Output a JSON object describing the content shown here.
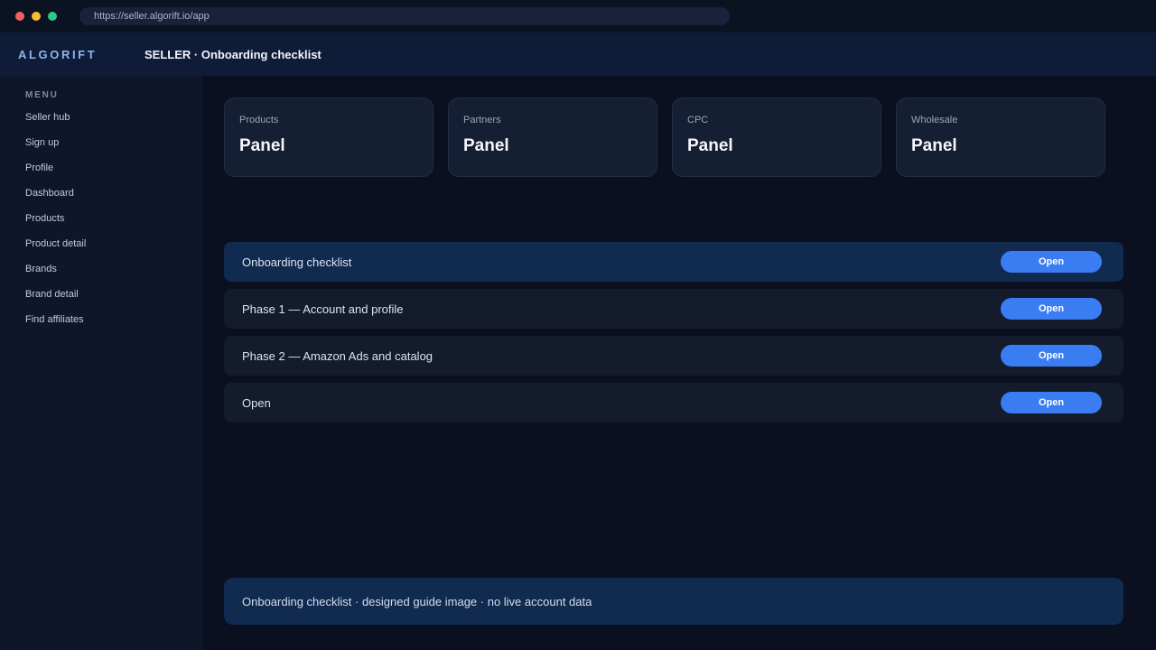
{
  "browser": {
    "url": "https://seller.algorift.io/app"
  },
  "header": {
    "logo": "ALGORIFT",
    "title": "SELLER · Onboarding checklist"
  },
  "sidebar": {
    "heading": "MENU",
    "items": [
      {
        "label": "Seller hub"
      },
      {
        "label": "Sign up"
      },
      {
        "label": "Profile"
      },
      {
        "label": "Dashboard"
      },
      {
        "label": "Products"
      },
      {
        "label": "Product detail"
      },
      {
        "label": "Brands"
      },
      {
        "label": "Brand detail"
      },
      {
        "label": "Find affiliates"
      }
    ]
  },
  "stats": [
    {
      "label": "Products",
      "value": "Panel"
    },
    {
      "label": "Partners",
      "value": "Panel"
    },
    {
      "label": "CPC",
      "value": "Panel"
    },
    {
      "label": "Wholesale",
      "value": "Panel"
    }
  ],
  "rows": [
    {
      "label": "Onboarding checklist",
      "button": "Open",
      "active": true
    },
    {
      "label": "Phase 1 — Account and profile",
      "button": "Open",
      "active": false
    },
    {
      "label": "Phase 2 — Amazon Ads and catalog",
      "button": "Open",
      "active": false
    },
    {
      "label": "Open",
      "button": "Open",
      "active": false
    }
  ],
  "footer": {
    "note": "Onboarding checklist · designed guide image · no live account data"
  },
  "colors": {
    "accent": "#3a7df2",
    "active_row": "#112a50",
    "background": "#0a1020"
  }
}
